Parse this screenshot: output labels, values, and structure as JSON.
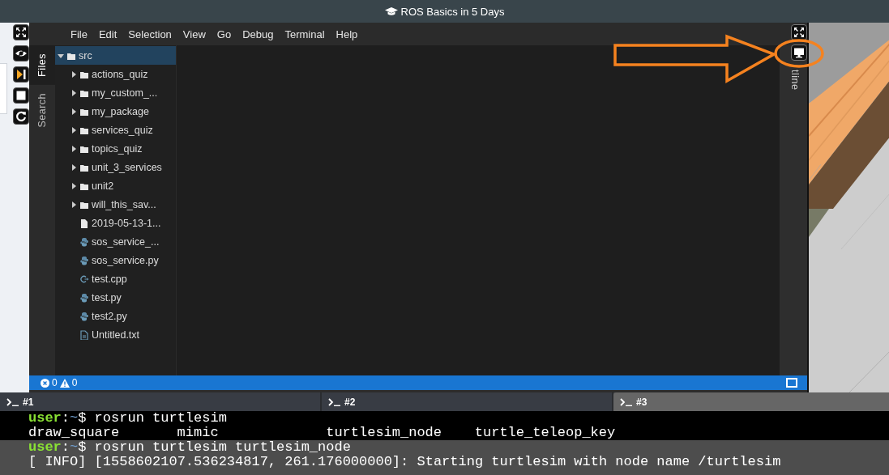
{
  "window": {
    "title": "ROS Basics in 5 Days"
  },
  "side_tools": [
    {
      "kind": "expand"
    },
    {
      "kind": "eye"
    },
    {
      "kind": "skip"
    },
    {
      "kind": "stop"
    },
    {
      "kind": "reload"
    }
  ],
  "menu": [
    "File",
    "Edit",
    "Selection",
    "View",
    "Go",
    "Debug",
    "Terminal",
    "Help"
  ],
  "activity_tabs": [
    {
      "label": "Files",
      "selected": true
    },
    {
      "label": "Search",
      "selected": false
    }
  ],
  "tree": [
    {
      "label": "src",
      "kind": "folder",
      "selected": true,
      "expanded": true,
      "children": [
        {
          "label": "actions_quiz",
          "kind": "folder",
          "selected": false,
          "expanded": false
        },
        {
          "label": "my_custom_...",
          "kind": "folder",
          "selected": false,
          "expanded": false
        },
        {
          "label": "my_package",
          "kind": "folder",
          "selected": false,
          "expanded": false
        },
        {
          "label": "services_quiz",
          "kind": "folder",
          "selected": false,
          "expanded": false
        },
        {
          "label": "topics_quiz",
          "kind": "folder",
          "selected": false,
          "expanded": false
        },
        {
          "label": "unit_3_services",
          "kind": "folder",
          "selected": false,
          "expanded": false
        },
        {
          "label": "unit2",
          "kind": "folder",
          "selected": false,
          "expanded": false
        },
        {
          "label": "will_this_sav...",
          "kind": "folder",
          "selected": false,
          "expanded": false
        },
        {
          "label": "2019-05-13-1...",
          "kind": "file",
          "selected": false
        },
        {
          "label": "sos_service_...",
          "kind": "python",
          "selected": false
        },
        {
          "label": "sos_service.py",
          "kind": "python",
          "selected": false
        },
        {
          "label": "test.cpp",
          "kind": "cpp",
          "selected": false
        },
        {
          "label": "test.py",
          "kind": "python",
          "selected": false
        },
        {
          "label": "test2.py",
          "kind": "python",
          "selected": false
        },
        {
          "label": "Untitled.txt",
          "kind": "text",
          "selected": false
        }
      ]
    }
  ],
  "right_panel": {
    "label": "tline"
  },
  "status_bar": {
    "errors": "0",
    "warnings": "0"
  },
  "terminal_tabs": [
    {
      "label": "#1",
      "selected": false
    },
    {
      "label": "#2",
      "selected": false
    },
    {
      "label": "#3",
      "selected": true
    }
  ],
  "terminal_lines": [
    {
      "kind": "prompt",
      "highlighted": false,
      "user": "user",
      "separator": ":",
      "path": "~",
      "symbol": "$",
      "command": "rosrun turtlesim"
    },
    {
      "kind": "columns",
      "highlighted": false,
      "items": [
        "draw_square",
        "mimic",
        "turtlesim_node",
        "turtle_teleop_key"
      ]
    },
    {
      "kind": "prompt",
      "highlighted": true,
      "user": "user",
      "separator": ":",
      "path": "~",
      "symbol": "$",
      "command": "rosrun turtlesim turtlesim_node"
    },
    {
      "kind": "output",
      "highlighted": true,
      "text": "[ INFO] [1558602107.536234817, 261.176000000]: Starting turtlesim with node name /turtlesim"
    }
  ]
}
